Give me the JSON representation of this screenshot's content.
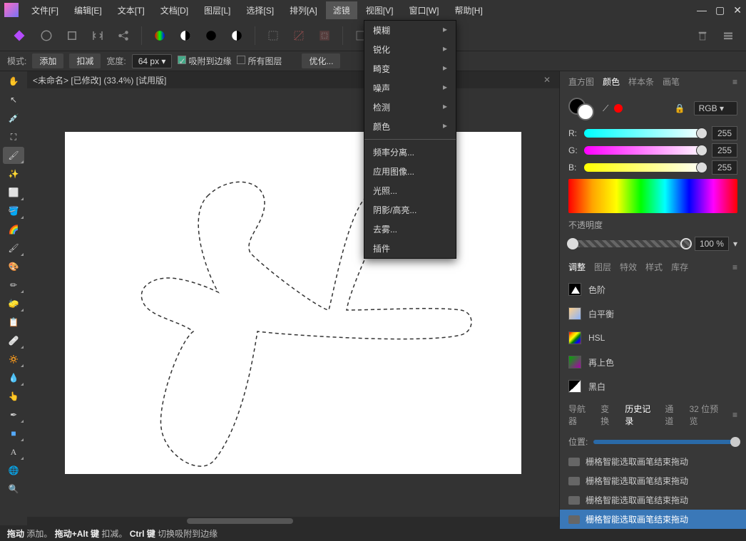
{
  "menus": [
    "文件[F]",
    "编辑[E]",
    "文本[T]",
    "文档[D]",
    "图层[L]",
    "选择[S]",
    "排列[A]",
    "滤镜",
    "视图[V]",
    "窗口[W]",
    "帮助[H]"
  ],
  "active_menu_index": 7,
  "filter_menu": {
    "group1": [
      "模糊",
      "锐化",
      "畸变",
      "噪声",
      "检测",
      "颜色"
    ],
    "group2": [
      "频率分离...",
      "应用图像...",
      "光照...",
      "阴影/高亮...",
      "去雾...",
      "插件"
    ]
  },
  "options": {
    "mode_label": "模式:",
    "add": "添加",
    "subtract": "扣减",
    "width_label": "宽度:",
    "width_value": "64 px",
    "snap_edges": "吸附到边缘",
    "all_layers": "所有图层",
    "refine": "优化..."
  },
  "doc_tab": "<未命名> [已修改] (33.4%) [试用版]",
  "right": {
    "tabs_top": [
      "直方图",
      "颜色",
      "样本条",
      "画笔"
    ],
    "active_top": 1,
    "colorspace": "RGB",
    "channels": {
      "r_label": "R:",
      "g_label": "G:",
      "b_label": "B:",
      "r": "255",
      "g": "255",
      "b": "255"
    },
    "opacity_label": "不透明度",
    "opacity_value": "100 %",
    "tabs_mid": [
      "调整",
      "图层",
      "特效",
      "样式",
      "库存"
    ],
    "active_mid": 0,
    "adjustments": [
      "色阶",
      "白平衡",
      "HSL",
      "再上色",
      "黑白"
    ],
    "tabs_hist": [
      "导航器",
      "变换",
      "历史记录",
      "通道",
      "32 位预览"
    ],
    "active_hist": 2,
    "pos_label": "位置:",
    "history_items": [
      "栅格智能选取画笔结束拖动",
      "栅格智能选取画笔结束拖动",
      "栅格智能选取画笔结束拖动",
      "栅格智能选取画笔结束拖动"
    ],
    "history_selected": 3
  },
  "status": {
    "drag": "拖动",
    "add": "添加。",
    "drag_alt": "拖动+Alt 键",
    "sub": "扣减。",
    "ctrl": "Ctrl 键",
    "snap": "切换吸附到边缘"
  }
}
